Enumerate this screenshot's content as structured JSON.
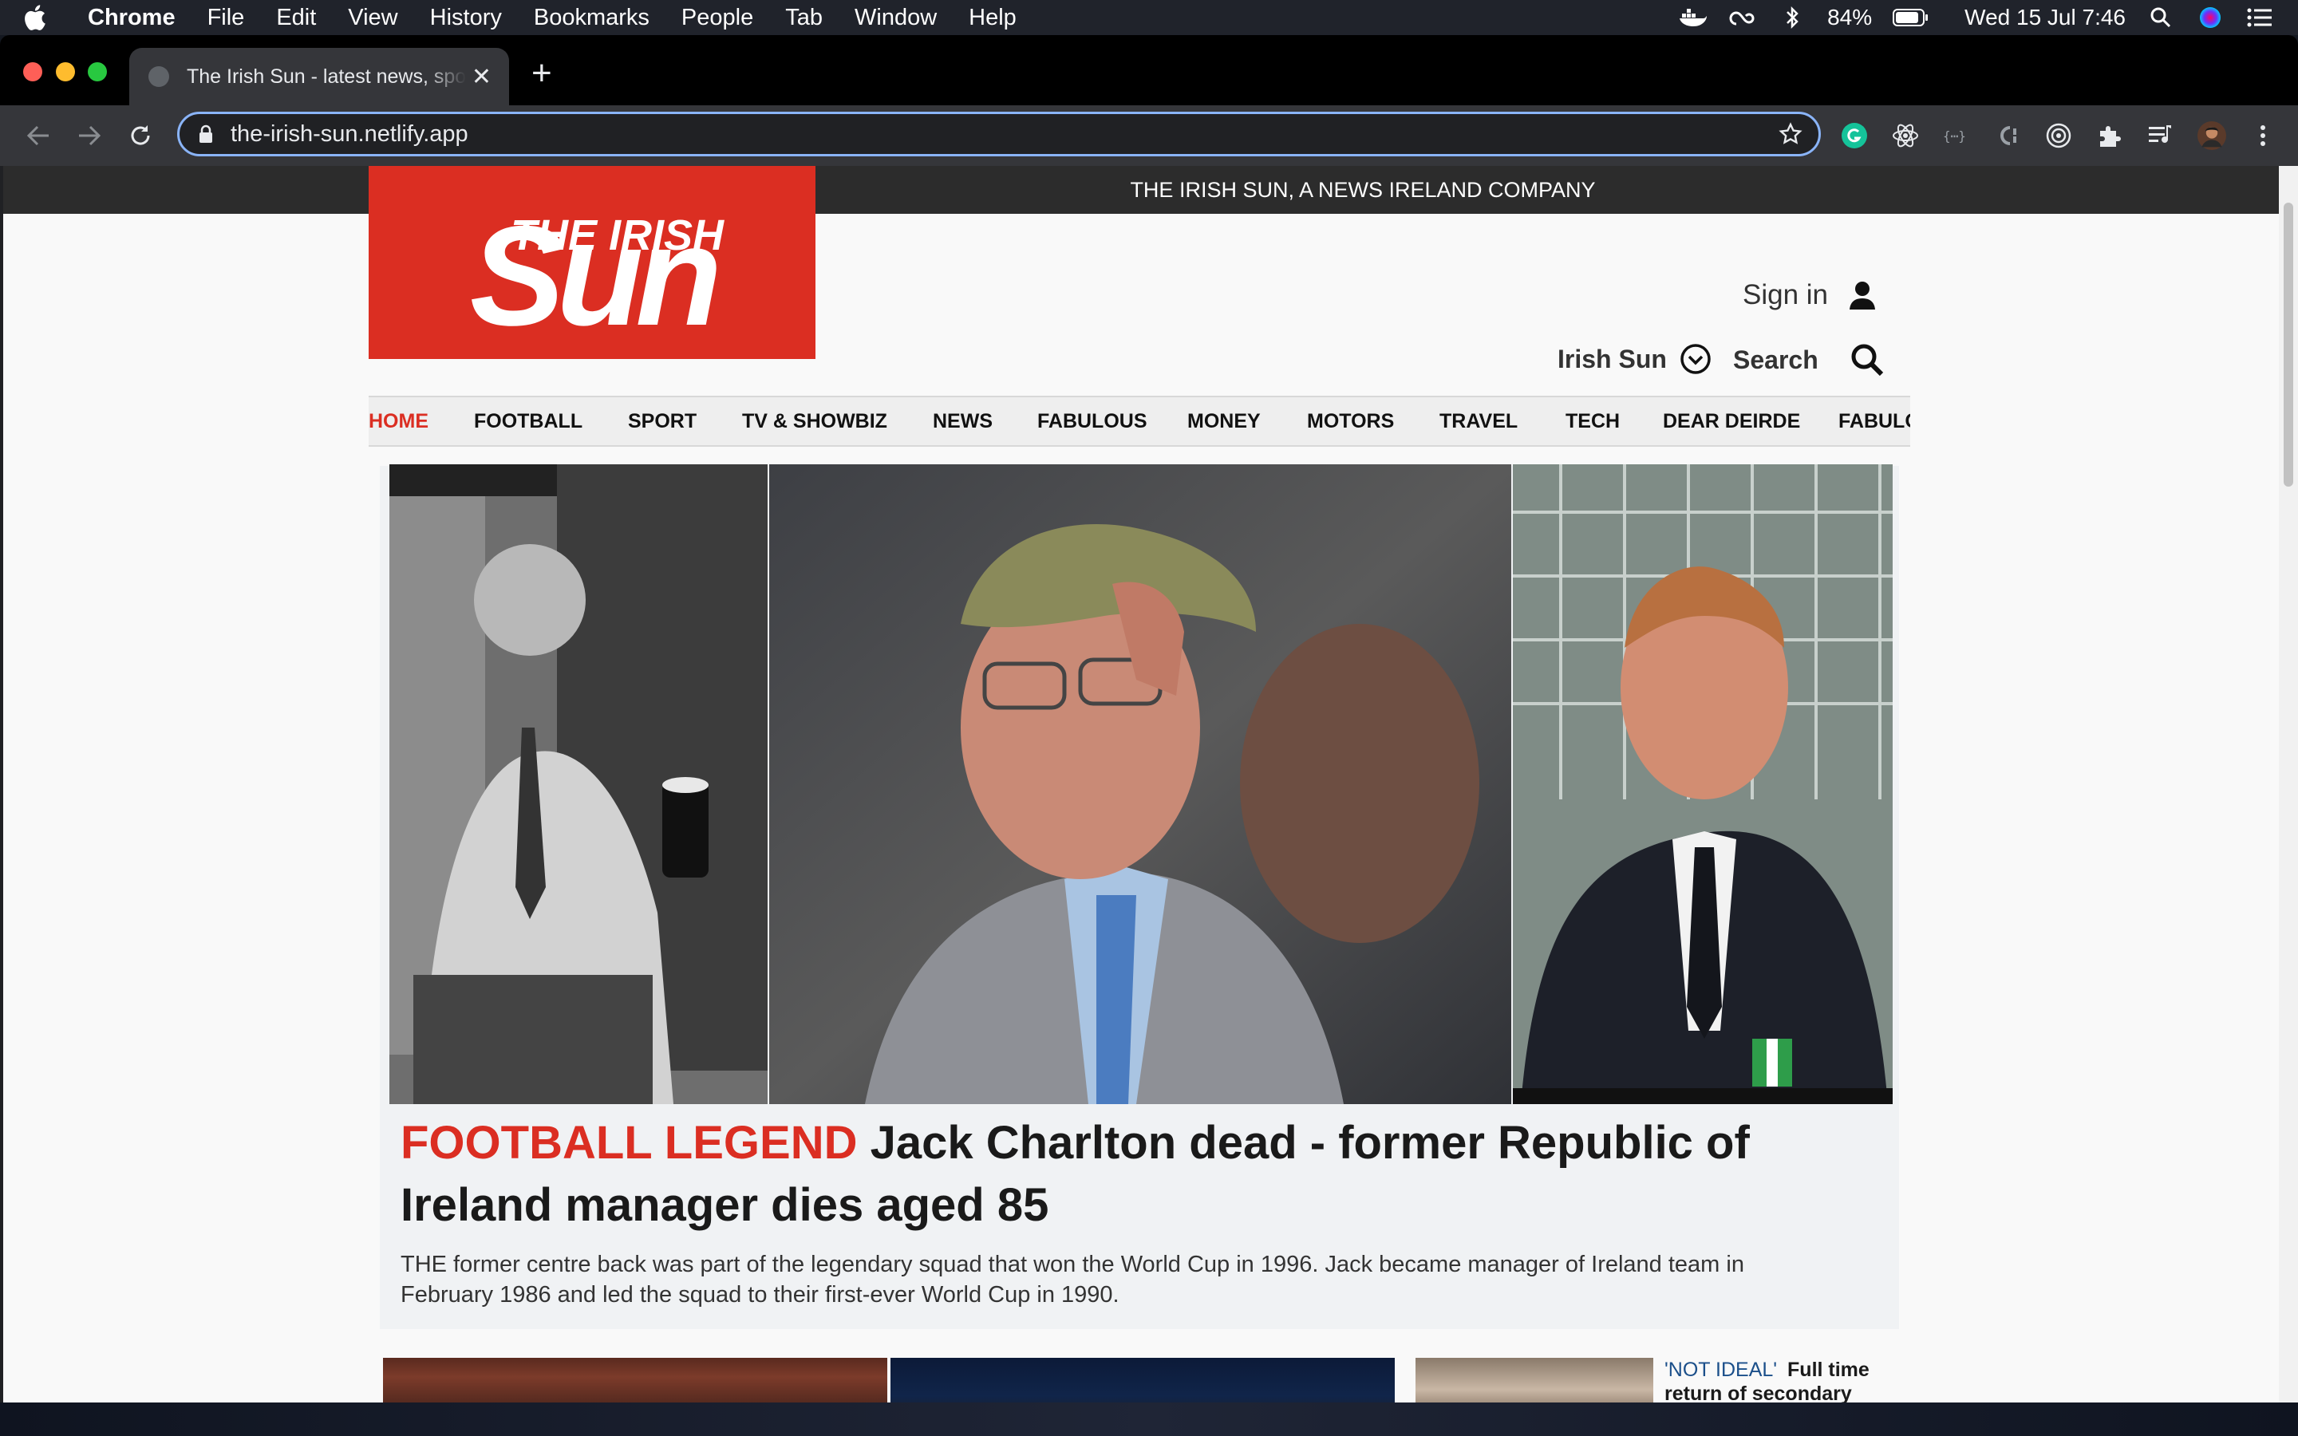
{
  "menubar": {
    "app_name": "Chrome",
    "items": [
      "File",
      "Edit",
      "View",
      "History",
      "Bookmarks",
      "People",
      "Tab",
      "Window",
      "Help"
    ],
    "battery": "84%",
    "clock": "Wed 15 Jul  7:46"
  },
  "browser": {
    "tab_title": "The Irish Sun - latest news, sport",
    "url": "the-irish-sun.netlify.app",
    "new_tab_label": "+"
  },
  "site": {
    "top_band": "THE IRISH SUN, A NEWS IRELAND COMPANY",
    "logo_top": "THE IRISH",
    "logo_main": "Sun",
    "sign_in": "Sign in",
    "edition": "Irish Sun",
    "search": "Search",
    "nav": [
      "HOME",
      "FOOTBALL",
      "SPORT",
      "TV & SHOWBIZ",
      "NEWS",
      "FABULOUS",
      "MONEY",
      "MOTORS",
      "TRAVEL",
      "TECH",
      "DEAR DEIRDE",
      "FABULO"
    ]
  },
  "hero": {
    "kicker": "FOOTBALL LEGEND",
    "headline": "Jack Charlton dead - former Republic of Ireland manager dies aged 85",
    "standfirst": "THE former centre back was part of the legendary squad that won the World Cup in 1996. Jack became manager of Ireland team in February 1986 and led the squad to their first-ever World Cup in 1990."
  },
  "teasers": [
    {
      "kicker": "'NOT IDEAL'",
      "headline": "Full time return of secondary students 'not possible'"
    }
  ],
  "colors": {
    "brand_red": "#db2e22",
    "top_band": "#2c2c2c",
    "omnibox_focus": "#8ab4f8"
  }
}
